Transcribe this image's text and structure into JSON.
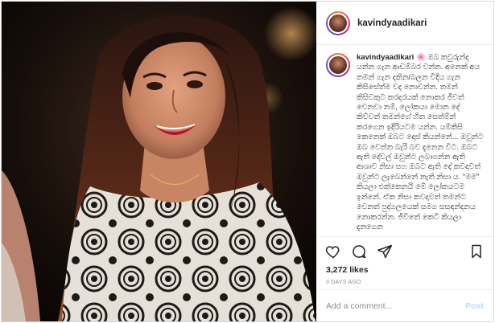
{
  "post": {
    "username": "kavindyaadikari",
    "photo_alt": "",
    "caption": {
      "username": "kavindyaadikari",
      "emoji": "🌸",
      "text": "ඔබ කවුරුන්ද යන්න ගැන ආඩම්බර වන්න. අනෙක් අය තමන් ගැන දකින/බලන විදිය ගැන කිසිසේත්ම වද නොවන්න. තමන් කිසිවකුට කරදරයක් නොකර ජීවත් වෙනවා නම්, ලෝකයා මොන දේ කිව්වත් තමන්ගේ හිත සෙත්ම්න් කරගෙන ඉදිරියටම යන්න. යම්කිසි කෙනෙක් ඔබට දොස් කියන්නේ... ඔවුන්ට ඔබ වෙන්න බැරි බව දැනෙන විට. ඔබට ඇති දේවල් ඔවුන්ට ලබාගන්න ඇති ආශාව නිසා සහ ඔබට ඇති දේ කවදාවත් ඔවුන්ට ලැබෙන්නේ නැති නිසා ය. \"මම\" කියලා එක්කෙනයි මේ ලෝකයටම ඉන්නේ. ඒක නිසා කවදාවත් තමන්ට වෙනත් පුද්ගලයෙක් සමග සසඳන්දනය නොකරන්න. ජීවිතේ කෙටි කියලා දැනගෙන"
    },
    "likes": "3,272 likes",
    "timestamp": "3 DAYS AGO",
    "add_comment_placeholder": "Add a comment...",
    "post_button": "Post",
    "icons": {
      "like": "heart-icon",
      "comment": "comment-icon",
      "share": "share-icon",
      "save": "bookmark-icon"
    },
    "colors": {
      "border": "#dbdbdb",
      "text": "#262626",
      "muted": "#8e8e8e",
      "post_button_disabled": "#b2dffc"
    }
  }
}
